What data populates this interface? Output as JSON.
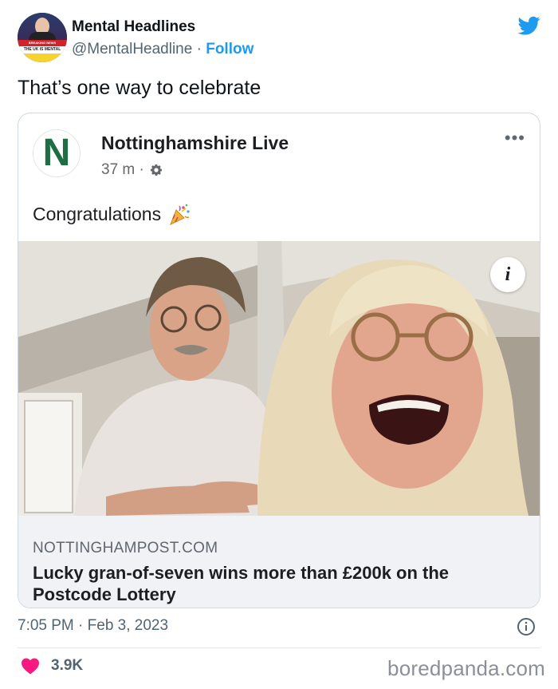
{
  "tweet": {
    "author_name": "Mental Headlines",
    "handle": "@MentalHeadline",
    "separator": "·",
    "follow_label": "Follow",
    "text": "That’s one way to celebrate",
    "time": "7:05 PM · Feb 3, 2023",
    "likes": "3.9K",
    "avatar_banner_top": "BREAKING NEWS",
    "avatar_banner_text": "THE UK IS MENTAL"
  },
  "embedded_post": {
    "page_logo_letter": "N",
    "page_name": "Nottinghamshire Live",
    "time_ago": "37 m ·",
    "more_icon": "•••",
    "post_text": "Congratulations",
    "info_glyph": "i",
    "link_domain": "NOTTINGHAMPOST.COM",
    "link_title": "Lucky gran-of-seven wins more than £200k on the Postcode Lottery"
  },
  "watermark": "boredpanda.com",
  "colors": {
    "twitter_blue": "#1d9bf0",
    "heart": "#f91880",
    "logo_green": "#1f6e43",
    "secondary_text": "#536471",
    "link_bg": "#f0f2f5"
  },
  "icons": [
    "twitter-bird-icon",
    "gear-icon",
    "party-popper-icon",
    "info-icon",
    "info-circle-icon",
    "heart-icon",
    "more-icon"
  ]
}
